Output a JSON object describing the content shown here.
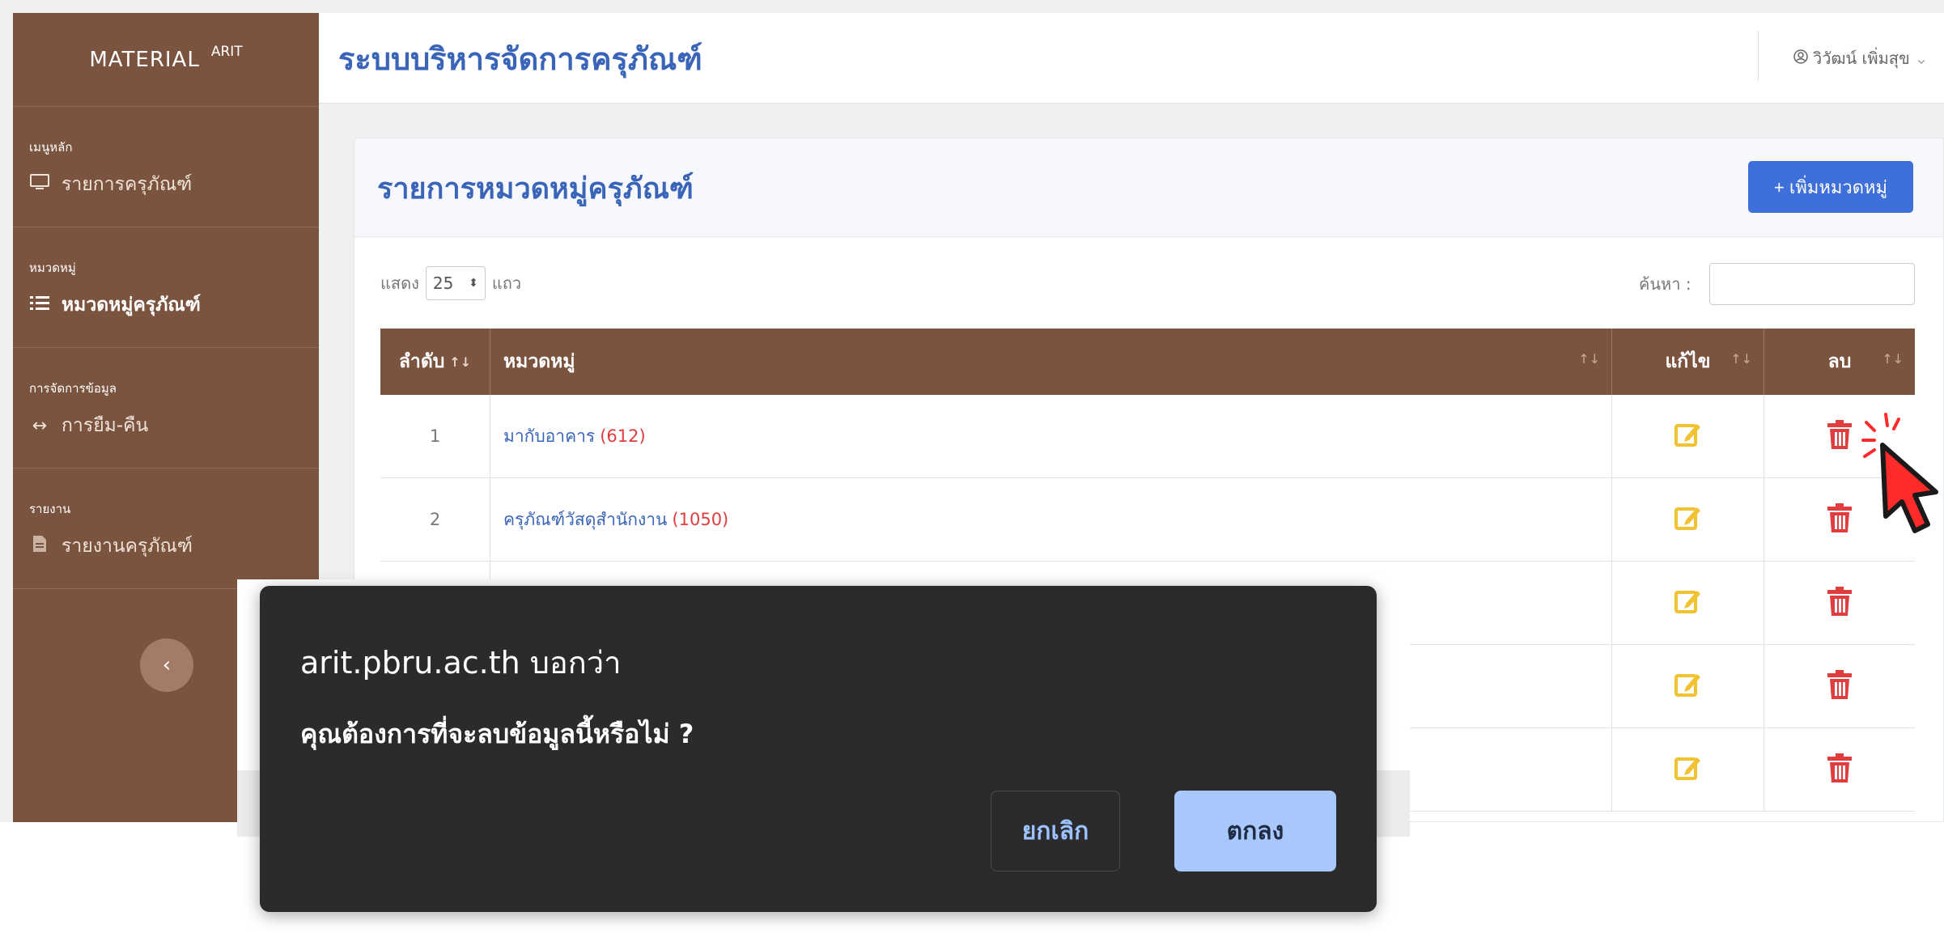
{
  "sidebar": {
    "brand_main": "MATERIAL",
    "brand_sub": "ARIT",
    "sections": [
      {
        "heading": "เมนูหลัก",
        "item": "รายการครุภัณฑ์",
        "icon": "monitor-icon"
      },
      {
        "heading": "หมวดหมู่",
        "item": "หมวดหมู่ครุภัณฑ์",
        "icon": "list-icon"
      },
      {
        "heading": "การจัดการข้อมูล",
        "item": "การยืม-คืน",
        "icon": "swap-arrows-icon"
      },
      {
        "heading": "รายงาน",
        "item": "รายงานครุภัณฑ์",
        "icon": "report-icon"
      }
    ]
  },
  "header": {
    "system_title": "ระบบบริหารจัดการครุภัณฑ์",
    "user_name": "วิวัฒน์ เพิ่มสุข"
  },
  "card": {
    "title": "รายการหมวดหมู่ครุภัณฑ์",
    "add_label": "+ เพิ่มหมวดหมู่"
  },
  "controls": {
    "show_label": "แสดง",
    "page_size": "25",
    "rows_label": "แถว",
    "search_label": "ค้นหา :",
    "search_value": ""
  },
  "table": {
    "headers": [
      "ลำดับ",
      "หมวดหมู่",
      "แก้ไข",
      "ลบ"
    ],
    "rows": [
      {
        "index": "1",
        "name": "มากับอาคาร",
        "count": "(612)"
      },
      {
        "index": "2",
        "name": "ครุภัณฑ์วัสดุสำนักงาน",
        "count": "(1050)"
      }
    ]
  },
  "dialog": {
    "origin": "arit.pbru.ac.th บอกว่า",
    "message": "คุณต้องการที่จะลบข้อมูลนี้หรือไม่ ?",
    "cancel_label": "ยกเลิก",
    "ok_label": "ตกลง"
  },
  "colors": {
    "sidebar_brown": "#7b5440",
    "accent_blue": "#3a64b8",
    "button_blue": "#3f6fd9",
    "edit_yellow": "#f1c232",
    "delete_red": "#e03e3e",
    "dialog_bg": "#2b2b2d",
    "dialog_ok": "#a8c7fa"
  }
}
